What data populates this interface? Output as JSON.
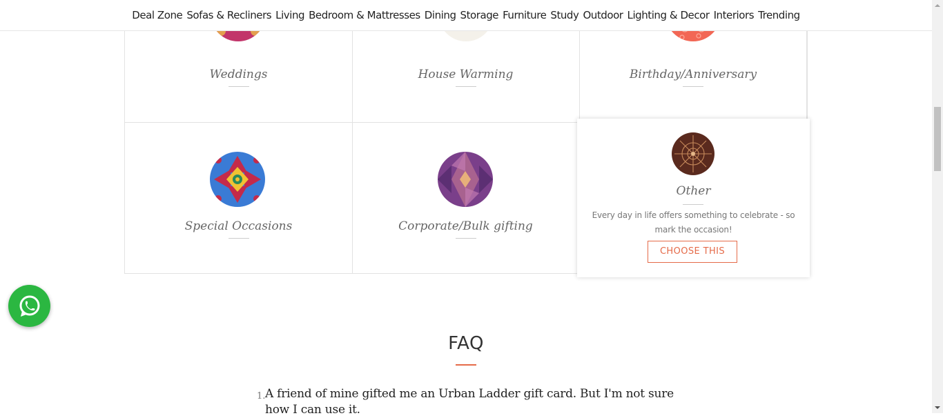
{
  "nav": {
    "items": [
      "Deal Zone",
      "Sofas & Recliners",
      "Living",
      "Bedroom & Mattresses",
      "Dining",
      "Storage",
      "Furniture",
      "Study",
      "Outdoor",
      "Lighting & Decor",
      "Interiors",
      "Trending"
    ]
  },
  "occasions": [
    {
      "name": "Weddings",
      "icon": "weddings-pattern-icon",
      "color": "#c2356a"
    },
    {
      "name": "House Warming",
      "icon": "house-warming-pattern-icon",
      "color": "#e8a54a"
    },
    {
      "name": "Birthday/Anniversary",
      "icon": "birthday-pattern-icon",
      "color": "#f26755"
    },
    {
      "name": "Special Occasions",
      "icon": "special-occasions-pattern-icon",
      "color": "#3a7bd5"
    },
    {
      "name": "Corporate/Bulk gifting",
      "icon": "corporate-pattern-icon",
      "color": "#7a3f8a"
    }
  ],
  "other": {
    "name": "Other",
    "description": "Every day in life offers something to celebrate - so mark the occasion!",
    "button": "CHOOSE THIS",
    "icon": "other-pattern-icon",
    "color": "#5a2a1e"
  },
  "whatsapp": {
    "icon": "whatsapp-icon",
    "color": "#2bb741"
  },
  "faq": {
    "title": "FAQ",
    "items": [
      {
        "number": "1.",
        "question": "A friend of mine gifted me an Urban Ladder gift card. But I'm not sure how I can use it."
      }
    ]
  },
  "accent_color": "#e56a48"
}
